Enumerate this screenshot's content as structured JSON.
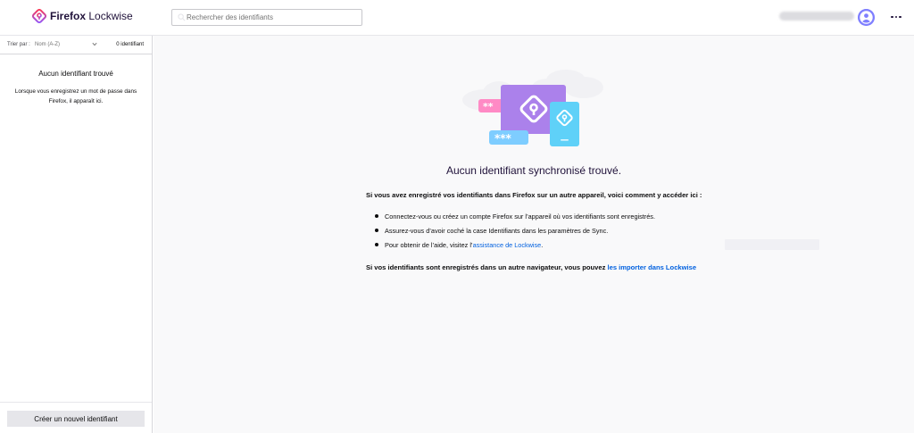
{
  "app": {
    "brand_bold": "Firefox",
    "brand_rest": " Lockwise",
    "accent": "#0060df",
    "brand_gradient": [
      "#ff3750",
      "#9059ff"
    ]
  },
  "search": {
    "placeholder": "Rechercher des identifiants",
    "value": ""
  },
  "account": {
    "avatar_icon": "user-avatar-icon",
    "menu_icon": "more-dots-icon"
  },
  "sidebar": {
    "sort_label": "Trier par :",
    "sort_value": "Nom (A-Z)",
    "count": "0 identifiant",
    "empty_title": "Aucun identifiant trouvé",
    "empty_description": "Lorsque vous enregistrez un mot de passe dans Firefox, il apparaît ici.",
    "create_button": "Créer un nouvel identifiant"
  },
  "main": {
    "heading": "Aucun identifiant synchronisé trouvé.",
    "intro": "Si vous avez enregistré vos identifiants dans Firefox sur un autre appareil, voici comment y accéder ici :",
    "steps": [
      "Connectez-vous ou créez un compte Firefox sur l’appareil où vos identifiants sont enregistrés.",
      "Assurez-vous d’avoir coché la case Identifiants dans les paramètres de Sync."
    ],
    "help_prefix": "Pour obtenir de l’aide, visitez l’",
    "help_link": "assistance de Lockwise",
    "help_suffix": ".",
    "outro_prefix": "Si vos identifiants sont enregistrés dans un autre navigateur, vous pouvez ",
    "outro_link": "les importer dans Lockwise",
    "illustration": {
      "masks": [
        "**",
        "***"
      ]
    }
  }
}
